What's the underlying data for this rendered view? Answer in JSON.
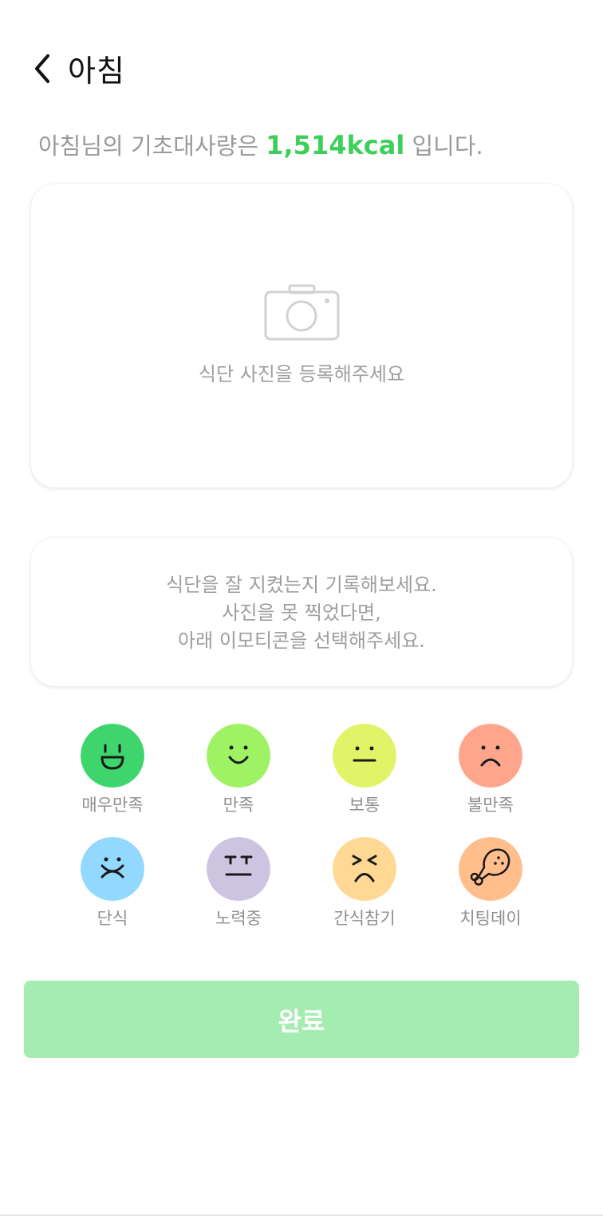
{
  "header": {
    "title": "아침",
    "back_icon": "chevron-left-icon"
  },
  "bmr": {
    "prefix": "아침님의 기초대사량은 ",
    "value": "1,514kcal",
    "suffix": " 입니다.",
    "accent_color": "#3ecf5a"
  },
  "photo": {
    "prompt": "식단 사진을 등록해주세요",
    "icon": "camera-icon"
  },
  "record": {
    "lines": [
      "식단을 잘 지켰는지 기록해보세요.",
      "사진을 못 찍었다면,",
      "아래 이모티콘을 선택해주세요."
    ]
  },
  "emotions": [
    {
      "label": "매우만족",
      "color": "#3fd56d",
      "icon": "big-smile-icon"
    },
    {
      "label": "만족",
      "color": "#9ef264",
      "icon": "smile-icon"
    },
    {
      "label": "보통",
      "color": "#e1f367",
      "icon": "neutral-face-icon"
    },
    {
      "label": "불만족",
      "color": "#ffa58c",
      "icon": "frown-icon"
    },
    {
      "label": "단식",
      "color": "#92d8ff",
      "icon": "sealed-mouth-icon"
    },
    {
      "label": "노력중",
      "color": "#cdc4e2",
      "icon": "straight-face-icon"
    },
    {
      "label": "간식참기",
      "color": "#ffd893",
      "icon": "squinting-frown-icon"
    },
    {
      "label": "치팅데이",
      "color": "#ffbe8c",
      "icon": "chicken-drumstick-icon"
    }
  ],
  "done_button": {
    "label": "완료",
    "color": "#a5ecb1"
  }
}
